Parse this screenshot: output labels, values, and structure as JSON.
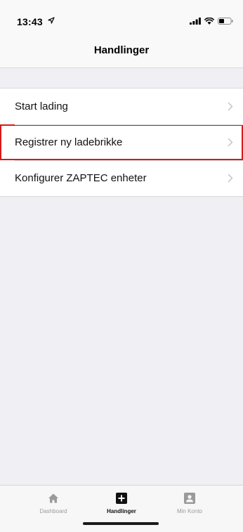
{
  "status_bar": {
    "time": "13:43",
    "icons": [
      "location-arrow-icon",
      "signal-icon",
      "wifi-icon",
      "battery-icon"
    ]
  },
  "nav": {
    "title": "Handlinger"
  },
  "actions": [
    {
      "label": "Start lading",
      "highlighted": false
    },
    {
      "label": "Registrer ny ladebrikke",
      "highlighted": true
    },
    {
      "label": "Konfigurer ZAPTEC enheter",
      "highlighted": false
    }
  ],
  "tabbar": {
    "tabs": [
      {
        "label": "Dashboard",
        "icon": "home-icon",
        "active": false
      },
      {
        "label": "Handlinger",
        "icon": "plus-square-icon",
        "active": true
      },
      {
        "label": "Min Konto",
        "icon": "account-icon",
        "active": false
      }
    ]
  },
  "colors": {
    "background": "#efeff4",
    "highlight_border": "#d61a1a",
    "inactive_tab": "#9a9a9a",
    "active_tab": "#111111"
  }
}
